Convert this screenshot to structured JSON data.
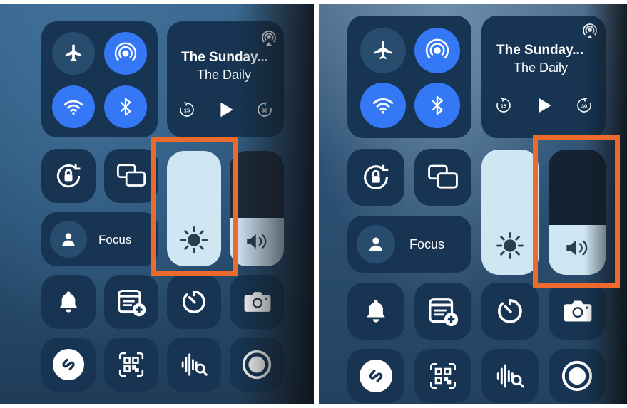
{
  "panels": [
    {
      "now_playing": {
        "title": "The Sunday...",
        "subtitle": "The Daily"
      },
      "focus": {
        "label": "Focus"
      },
      "brightness_level": 1.0,
      "volume_level": 0.42,
      "highlight": "brightness-slider"
    },
    {
      "now_playing": {
        "title": "The Sunday...",
        "subtitle": "The Daily"
      },
      "focus": {
        "label": "Focus"
      },
      "brightness_level": 1.0,
      "volume_level": 0.4,
      "highlight": "volume-slider"
    }
  ],
  "colors": {
    "accent_blue": "#3478f6",
    "highlight_orange": "#ec6a2c",
    "tile": "#173553",
    "slider_fill": "#cfe6f3"
  },
  "icons": [
    "airplane-icon",
    "airdrop-icon",
    "wifi-icon",
    "bluetooth-icon",
    "airplay-icon",
    "skip-back-15-icon",
    "play-icon",
    "skip-forward-30-icon",
    "rotation-lock-icon",
    "screen-mirroring-icon",
    "brightness-icon",
    "volume-icon",
    "person-icon",
    "bell-icon",
    "quick-note-icon",
    "timer-icon",
    "camera-icon",
    "shazam-icon",
    "qr-code-icon",
    "sound-recognition-icon",
    "screen-record-icon"
  ]
}
